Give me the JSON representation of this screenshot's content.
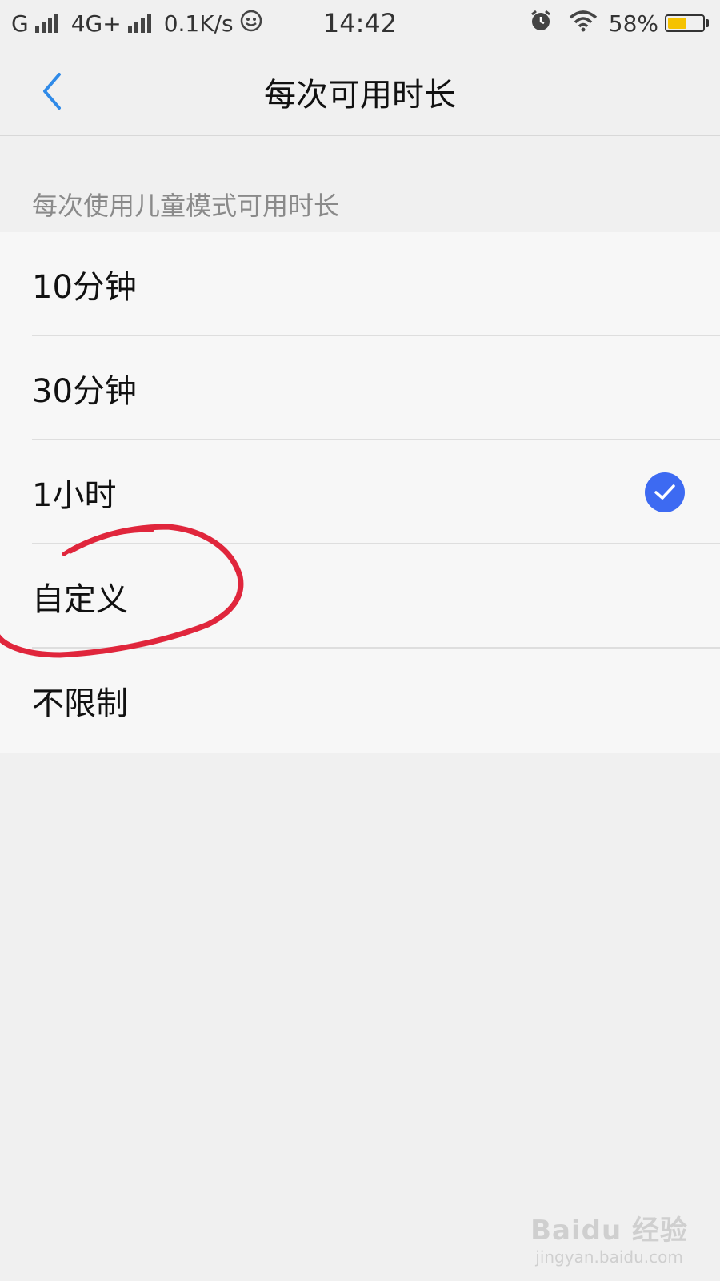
{
  "status_bar": {
    "carrier1": "G",
    "carrier2": "4G+",
    "net_speed": "0.1K/s",
    "time": "14:42",
    "battery_text": "58%",
    "battery_level": 0.58,
    "battery_color": "#f5c200"
  },
  "nav": {
    "title": "每次可用时长"
  },
  "section": {
    "header": "每次使用儿童模式可用时长"
  },
  "options": [
    {
      "label": "10分钟",
      "selected": false
    },
    {
      "label": "30分钟",
      "selected": false
    },
    {
      "label": "1小时",
      "selected": true
    },
    {
      "label": "自定义",
      "selected": false
    },
    {
      "label": "不限制",
      "selected": false
    }
  ],
  "colors": {
    "accent": "#3d6af2",
    "back_arrow": "#2f8ae8",
    "annotation": "#e0263c"
  },
  "watermark": {
    "logo": "Baidu 经验",
    "url": "jingyan.baidu.com"
  }
}
